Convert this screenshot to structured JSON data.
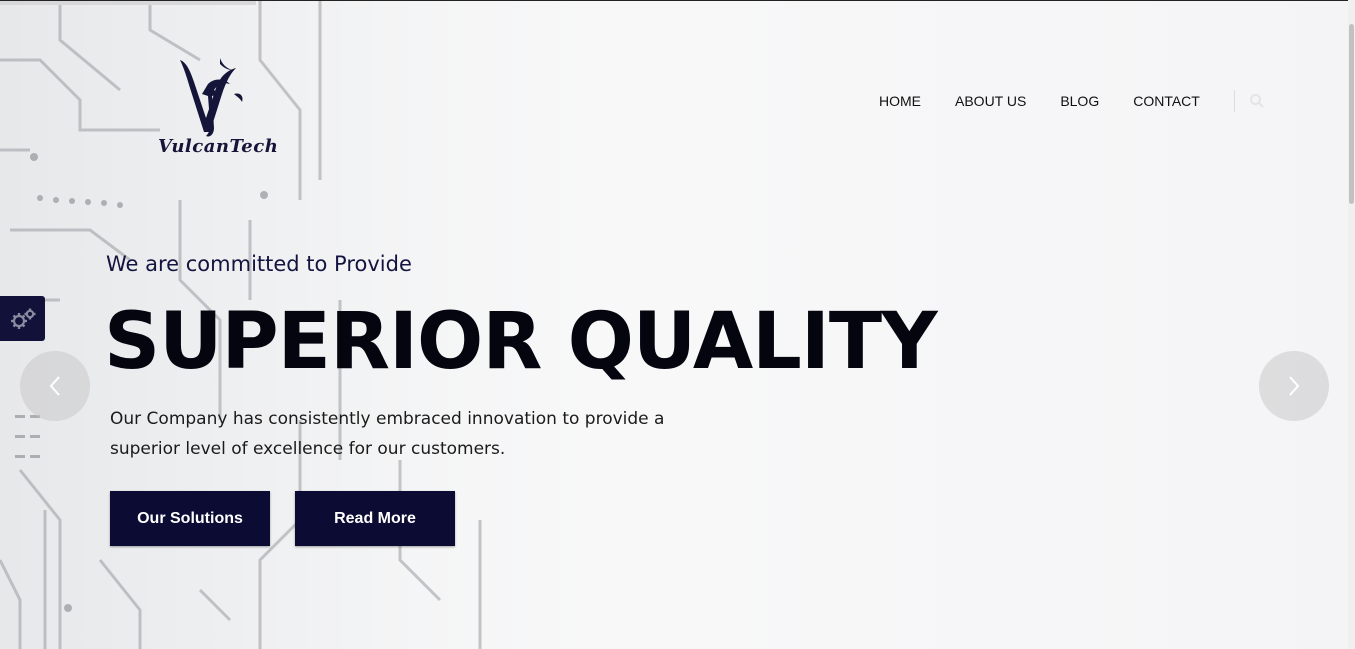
{
  "brand": {
    "name": "VulcanTech",
    "logo_text": "VulcanTech"
  },
  "nav": {
    "items": [
      {
        "label": "HOME"
      },
      {
        "label": "ABOUT US"
      },
      {
        "label": "BLOG"
      },
      {
        "label": "CONTACT"
      }
    ],
    "search_icon": "search-icon"
  },
  "hero": {
    "kicker": "We are committed to Provide",
    "title": "SUPERIOR QUALITY",
    "description_line1": "Our Company has consistently embraced innovation to provide a",
    "description_line2": "superior level of excellence for our customers.",
    "buttons": [
      {
        "label": "Our Solutions"
      },
      {
        "label": "Read More"
      }
    ]
  },
  "slider": {
    "prev_icon": "chevron-left-icon",
    "next_icon": "chevron-right-icon"
  },
  "settings": {
    "icon": "gears-icon"
  },
  "colors": {
    "primary": "#0b0b33",
    "text_dark": "#050510",
    "kicker": "#141440"
  }
}
